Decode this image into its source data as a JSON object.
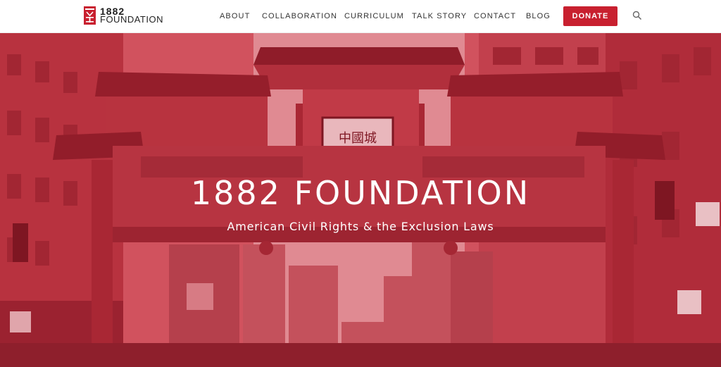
{
  "header": {
    "logo": {
      "line1": "1882",
      "line2": "FOUNDATION"
    },
    "nav": [
      {
        "label": "ABOUT"
      },
      {
        "label": "COLLABORATION"
      },
      {
        "label": "CURRICULUM"
      },
      {
        "label": "TALK STORY"
      },
      {
        "label": "CONTACT"
      },
      {
        "label": "BLOG"
      }
    ],
    "donate_label": "DONATE",
    "search_icon": "search-icon"
  },
  "hero": {
    "title": "1882 FOUNDATION",
    "subtitle": "American Civil Rights & the Exclusion Laws",
    "gate_sign": "中國城"
  },
  "colors": {
    "brand_red": "#c8202f",
    "hero_tint": "#c73a47"
  }
}
